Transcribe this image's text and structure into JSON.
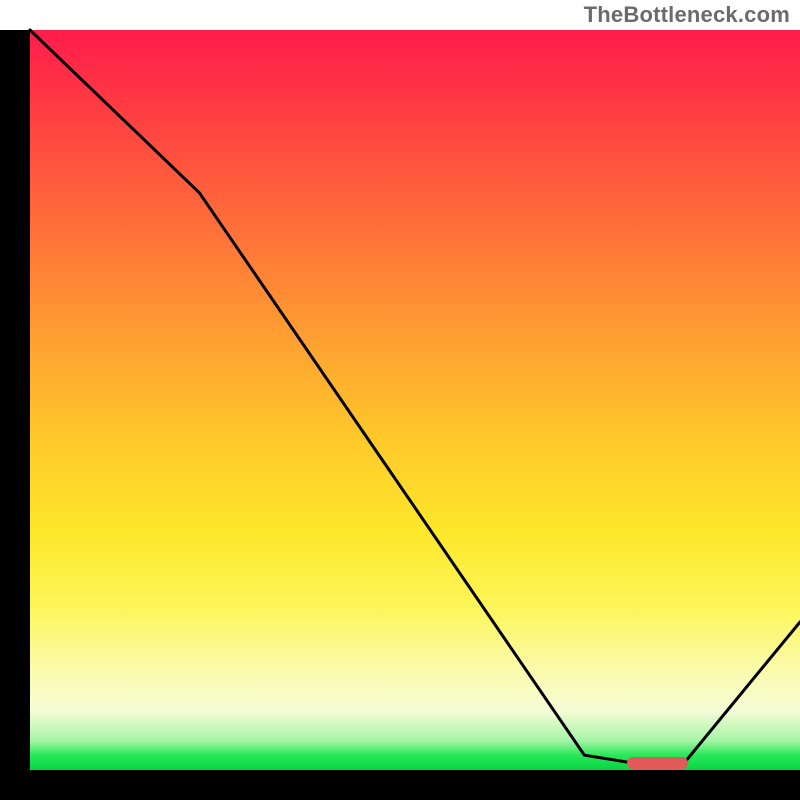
{
  "watermark": "TheBottleneck.com",
  "colors": {
    "axis": "#000000",
    "curve_stroke": "#000000",
    "marker": "#e15a5a",
    "gradient_top": "#ff1c4b",
    "gradient_bottom": "#07d443"
  },
  "chart_data": {
    "type": "line",
    "title": "",
    "xlabel": "",
    "ylabel": "",
    "xlim": [
      0,
      100
    ],
    "ylim": [
      0,
      100
    ],
    "grid": false,
    "legend": false,
    "series": [
      {
        "name": "bottleneck-curve",
        "x": [
          0,
          22,
          72,
          78,
          85,
          100
        ],
        "values": [
          100,
          78,
          2,
          1,
          1,
          20
        ]
      }
    ],
    "marker": {
      "name": "optimal-range",
      "x_start": 78,
      "x_end": 85,
      "y": 1
    }
  }
}
